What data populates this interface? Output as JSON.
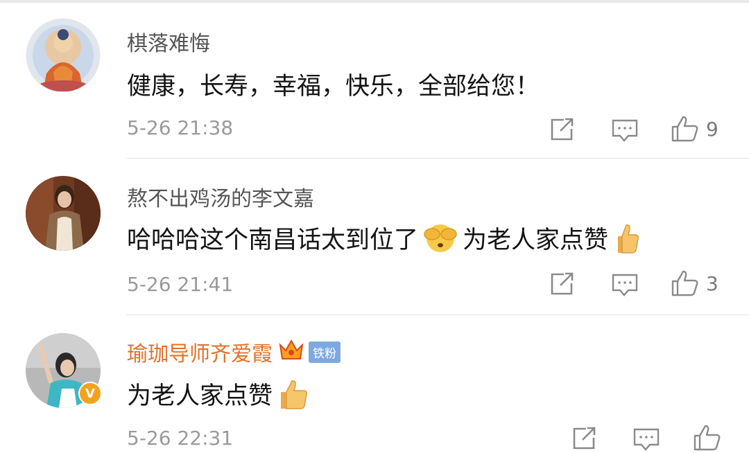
{
  "comments": [
    {
      "username": "棋落难悔",
      "text": "健康，长寿，幸福，快乐，全部给您！",
      "timestamp": "5-26 21:38",
      "like_count": "9",
      "avatar": "buddha-avatar"
    },
    {
      "username": "熬不出鸡汤的李文嘉",
      "text_before_emoji": "哈哈哈这个南昌话太到位了",
      "text_after_emoji": "为老人家点赞",
      "timestamp": "5-26 21:41",
      "like_count": "3",
      "avatar": "woman-avatar"
    },
    {
      "username": "瑜珈导师齐爱霞",
      "fan_badge": "铁粉",
      "text": "为老人家点赞",
      "timestamp": "5-26 22:31",
      "like_count": "",
      "avatar": "yoga-avatar",
      "verified_mark": "V"
    }
  ],
  "icons": [
    "repost-icon",
    "comment-icon",
    "like-icon"
  ],
  "colors": {
    "vip_name": "#e0722b",
    "badge_bg": "#7ea9e0",
    "verified_bg": "#f4a21d",
    "icon_gray": "#8a8a8a"
  }
}
